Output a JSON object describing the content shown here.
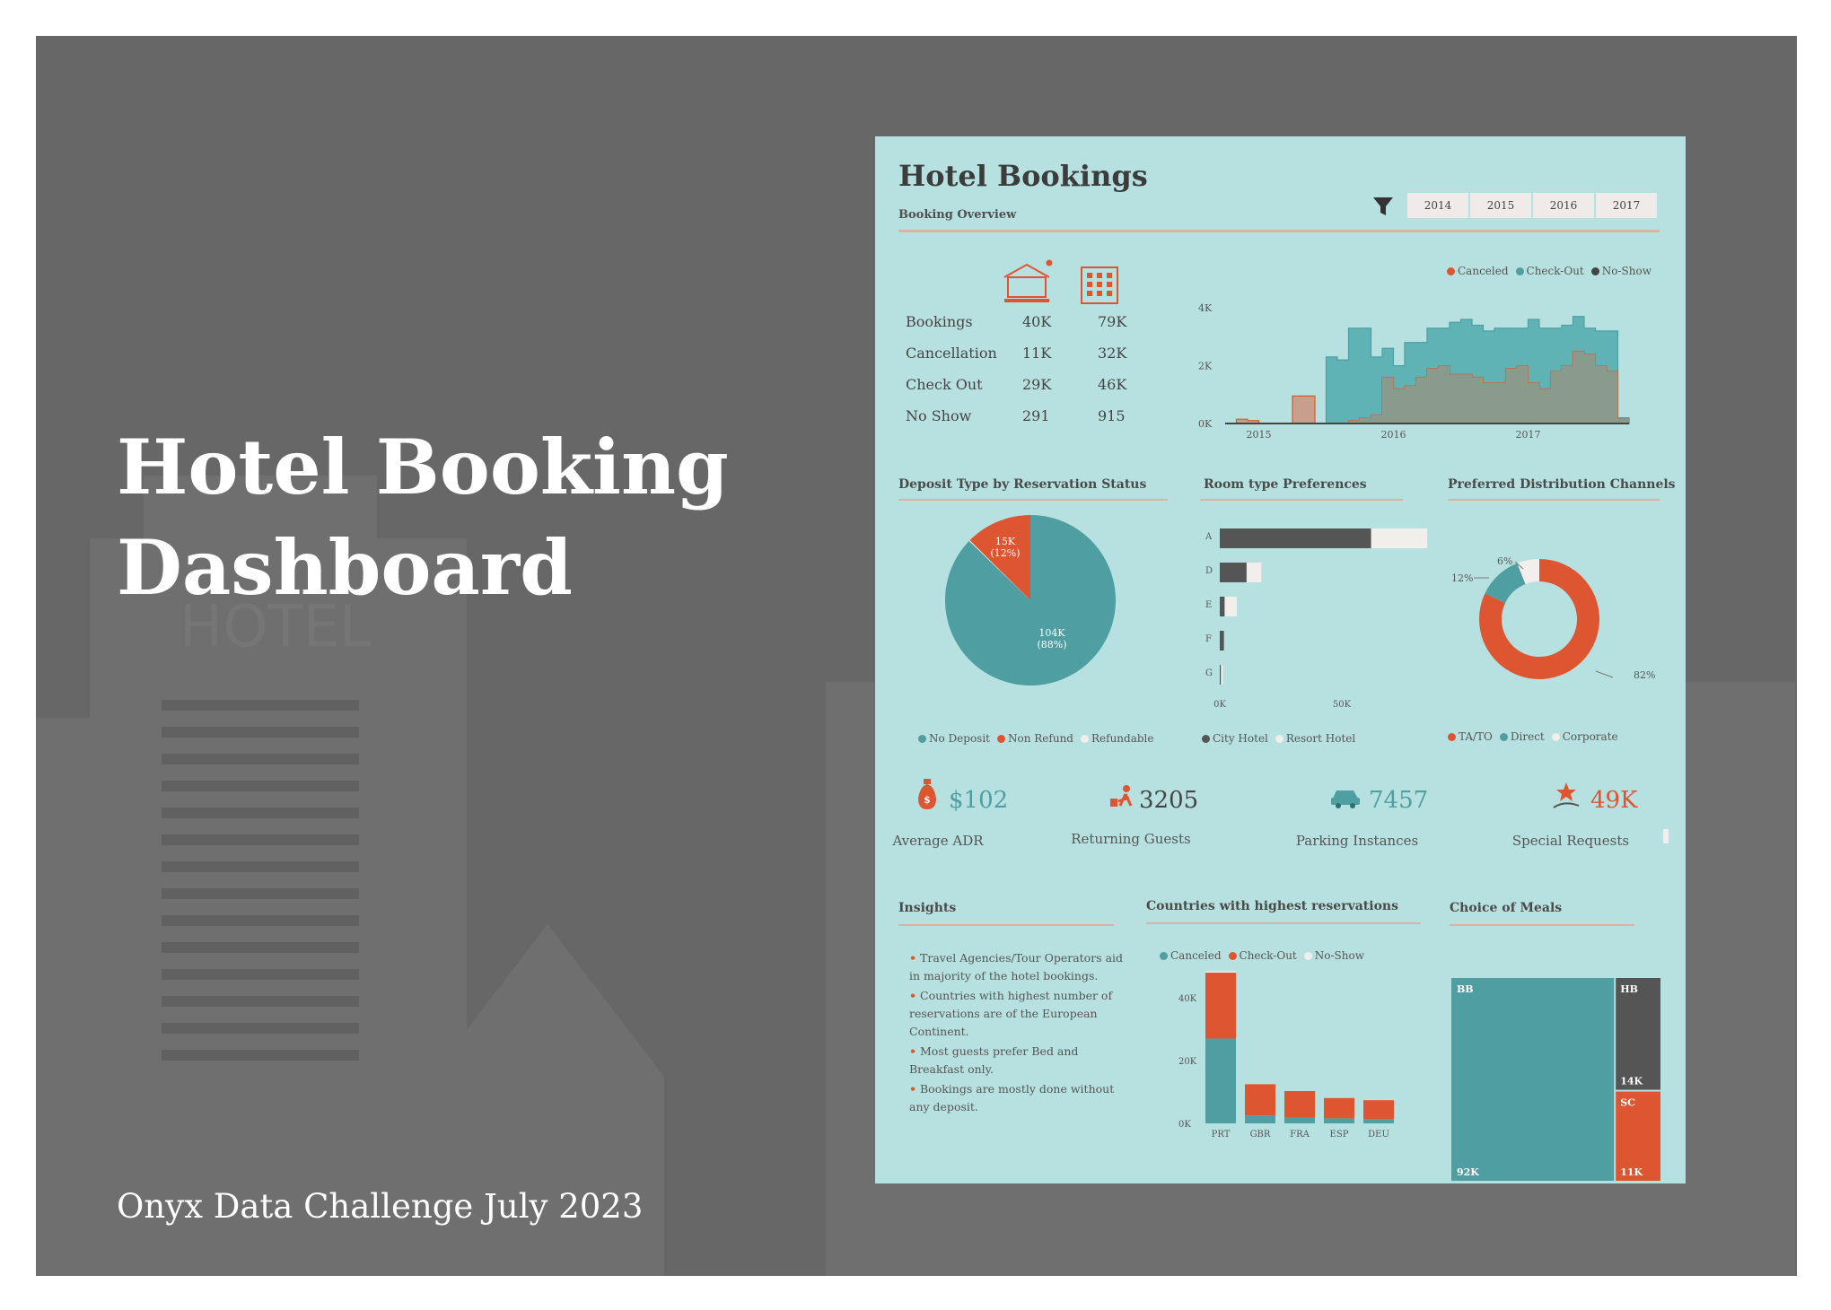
{
  "slide": {
    "title_line1": "Hotel Booking",
    "title_line2": "Dashboard",
    "footer": "Onyx Data Challenge July 2023",
    "background_sign": "HOTEL"
  },
  "colors": {
    "teal": "#4e9ea2",
    "orange": "#dd5631",
    "dark": "#555555",
    "light": "#f1eeec",
    "panel": "#b7e1e0",
    "slide_bg": "#676767"
  },
  "dashboard": {
    "title": "Hotel Bookings",
    "subtitle": "Booking Overview",
    "filter_icon": "funnel-icon",
    "years": [
      "2014",
      "2015",
      "2016",
      "2017"
    ],
    "stats": {
      "icons": [
        "resort-hotel-icon",
        "city-hotel-icon"
      ],
      "rows": [
        {
          "label": "Bookings",
          "v1": "40K",
          "v2": "79K"
        },
        {
          "label": "Cancellation",
          "v1": "11K",
          "v2": "32K"
        },
        {
          "label": "Check Out",
          "v1": "29K",
          "v2": "46K"
        },
        {
          "label": "No Show",
          "v1": "291",
          "v2": "915"
        }
      ]
    },
    "sections": {
      "deposit": "Deposit Type by Reservation Status",
      "room": "Room type Preferences",
      "channels": "Preferred Distribution Channels",
      "insights": "Insights",
      "countries": "Countries with highest reservations",
      "meals": "Choice of Meals"
    },
    "kpis": [
      {
        "icon": "money-bag-icon",
        "value": "$102",
        "label": "Average ADR"
      },
      {
        "icon": "traveler-icon",
        "value": "3205",
        "label": "Returning Guests"
      },
      {
        "icon": "car-icon",
        "value": "7457",
        "label": "Parking Instances"
      },
      {
        "icon": "star-hand-icon",
        "value": "49K",
        "label": "Special Requests"
      }
    ],
    "insights": [
      "Travel Agencies/Tour Operators aid in majority of the hotel bookings.",
      "Countries with highest number of reservations are of the European Continent.",
      "Most guests prefer Bed and Breakfast only.",
      "Bookings are mostly done without any deposit."
    ]
  },
  "chart_data": [
    {
      "type": "area",
      "legend": [
        "Canceled",
        "Check-Out",
        "No-Show"
      ],
      "yticks": [
        "0K",
        "2K",
        "4K"
      ],
      "xticks": [
        "2015",
        "2016",
        "2017"
      ],
      "ylim": [
        0,
        4500
      ],
      "x": [
        "2014-10",
        "2014-11",
        "2014-12",
        "2015-01",
        "2015-02",
        "2015-03",
        "2015-04",
        "2015-05",
        "2015-06",
        "2015-07",
        "2015-08",
        "2015-09",
        "2015-10",
        "2015-11",
        "2015-12",
        "2016-01",
        "2016-02",
        "2016-03",
        "2016-04",
        "2016-05",
        "2016-06",
        "2016-07",
        "2016-08",
        "2016-09",
        "2016-10",
        "2016-11",
        "2016-12",
        "2017-01",
        "2017-02",
        "2017-03",
        "2017-04",
        "2017-05",
        "2017-06",
        "2017-07",
        "2017-08",
        "2017-09"
      ],
      "series": [
        {
          "name": "Check-Out",
          "values": [
            0,
            0,
            0,
            0,
            0,
            0,
            0,
            0,
            0,
            2300,
            2200,
            3300,
            3300,
            2300,
            2600,
            2000,
            2800,
            2800,
            3300,
            3300,
            3500,
            3600,
            3400,
            3200,
            3300,
            3300,
            3300,
            3600,
            3300,
            3300,
            3400,
            3700,
            3300,
            3200,
            3200,
            200
          ]
        },
        {
          "name": "Canceled",
          "values": [
            0,
            150,
            100,
            0,
            0,
            0,
            950,
            950,
            0,
            0,
            0,
            100,
            200,
            300,
            1600,
            1200,
            1300,
            1600,
            1900,
            2000,
            1700,
            1700,
            1600,
            1400,
            1400,
            1900,
            2000,
            1400,
            1200,
            1800,
            2000,
            2500,
            2400,
            2000,
            1800,
            150
          ]
        },
        {
          "name": "No-Show",
          "values": [
            0,
            0,
            0,
            0,
            0,
            0,
            0,
            0,
            0,
            0,
            0,
            0,
            0,
            0,
            0,
            0,
            0,
            0,
            0,
            0,
            0,
            0,
            0,
            0,
            0,
            0,
            0,
            0,
            0,
            0,
            0,
            0,
            0,
            0,
            0,
            0
          ]
        }
      ]
    },
    {
      "type": "pie",
      "legend": [
        "No Deposit",
        "Non Refund",
        "Refundable"
      ],
      "slices": [
        {
          "name": "No Deposit",
          "value": 104,
          "label": "104K",
          "pct": "(88%)"
        },
        {
          "name": "Non Refund",
          "value": 15,
          "label": "15K",
          "pct": "(12%)"
        },
        {
          "name": "Refundable",
          "value": 0.2,
          "label": "",
          "pct": ""
        }
      ]
    },
    {
      "type": "bar",
      "orientation": "horizontal",
      "categories": [
        "A",
        "D",
        "E",
        "F",
        "G"
      ],
      "legend": [
        "City Hotel",
        "Resort Hotel"
      ],
      "xticks": [
        "0K",
        "50K"
      ],
      "xlim": [
        0,
        100000
      ],
      "series": [
        {
          "name": "City Hotel",
          "values": [
            62000,
            11000,
            2000,
            1700,
            500
          ]
        },
        {
          "name": "Resort Hotel",
          "values": [
            23000,
            6000,
            5000,
            0,
            800
          ]
        }
      ]
    },
    {
      "type": "pie",
      "donut": true,
      "legend": [
        "TA/TO",
        "Direct",
        "Corporate"
      ],
      "slices": [
        {
          "name": "TA/TO",
          "value": 82,
          "label": "82%"
        },
        {
          "name": "Direct",
          "value": 12,
          "label": "12%"
        },
        {
          "name": "Corporate",
          "value": 6,
          "label": "6%"
        }
      ]
    },
    {
      "type": "bar",
      "stacked": true,
      "categories": [
        "PRT",
        "GBR",
        "FRA",
        "ESP",
        "DEU"
      ],
      "legend": [
        "Canceled",
        "Check-Out",
        "No-Show"
      ],
      "yticks": [
        "0K",
        "20K",
        "40K"
      ],
      "ylim": [
        0,
        50000
      ],
      "series": [
        {
          "name": "Check-Out",
          "values": [
            27000,
            2500,
            1800,
            1600,
            1400
          ]
        },
        {
          "name": "Canceled",
          "values": [
            21000,
            10000,
            8500,
            6500,
            6000
          ]
        },
        {
          "name": "No-Show",
          "values": [
            400,
            50,
            50,
            50,
            30
          ]
        }
      ]
    },
    {
      "type": "treemap",
      "items": [
        {
          "name": "BB",
          "value": 92000,
          "label": "92K"
        },
        {
          "name": "HB",
          "value": 14000,
          "label": "14K"
        },
        {
          "name": "SC",
          "value": 11000,
          "label": "11K"
        }
      ]
    }
  ]
}
